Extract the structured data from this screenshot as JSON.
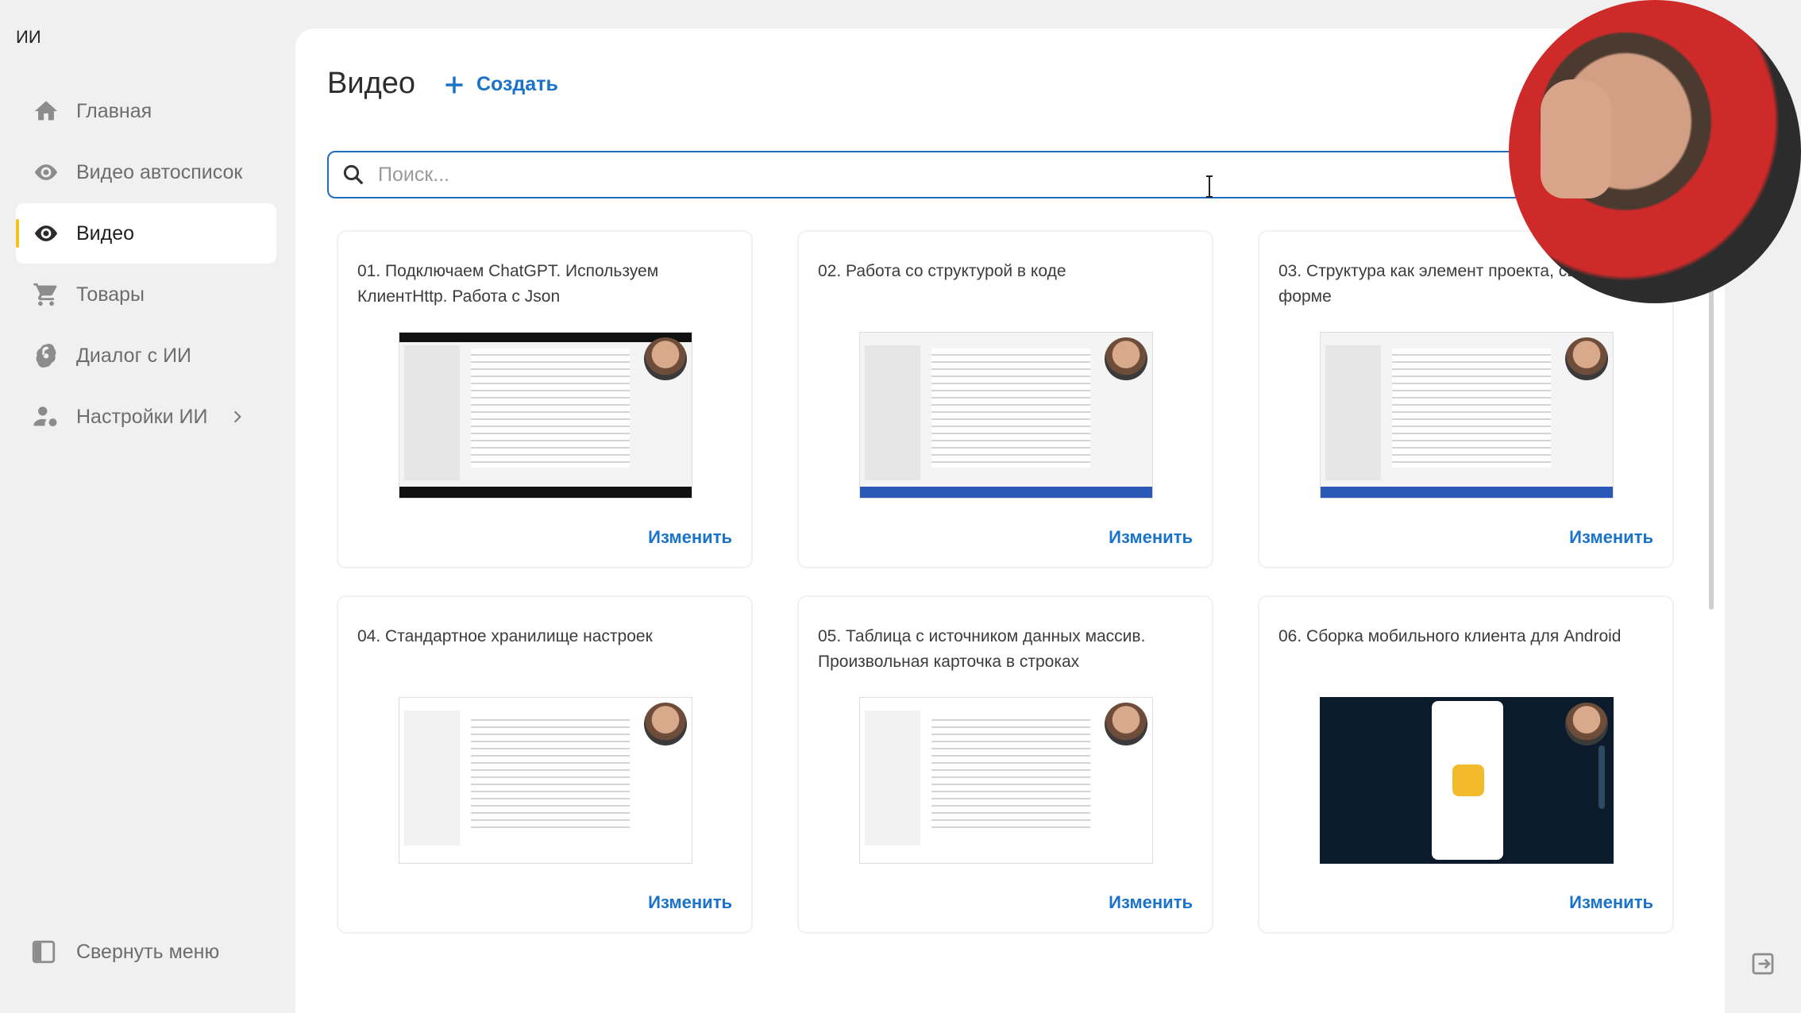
{
  "app": {
    "title": "ИИ"
  },
  "sidebar": {
    "items": [
      {
        "label": "Главная",
        "icon": "home-icon",
        "active": false
      },
      {
        "label": "Видео автосписок",
        "icon": "eye-icon",
        "active": false
      },
      {
        "label": "Видео",
        "icon": "eye-icon",
        "active": true
      },
      {
        "label": "Товары",
        "icon": "cart-icon",
        "active": false
      },
      {
        "label": "Диалог с ИИ",
        "icon": "openai-icon",
        "active": false
      },
      {
        "label": "Настройки ИИ",
        "icon": "user-settings-icon",
        "active": false,
        "has_submenu": true
      }
    ],
    "collapse_label": "Свернуть меню"
  },
  "main": {
    "title": "Видео",
    "create_label": "Создать",
    "search": {
      "placeholder": "Поиск...",
      "value": ""
    },
    "cards": [
      {
        "title": "01. Подключаем ChatGPT. Используем КлиентHttp. Работа с Json",
        "edit_label": "Изменить"
      },
      {
        "title": "02. Работа со структурой в коде",
        "edit_label": "Изменить"
      },
      {
        "title": "03. Структура как элемент проекта, свойство на форме",
        "edit_label": "Изменить"
      },
      {
        "title": "04. Стандартное хранилище настроек",
        "edit_label": "Изменить"
      },
      {
        "title": "05. Таблица с источником данных массив. Произвольная карточка в строках",
        "edit_label": "Изменить"
      },
      {
        "title": "06. Сборка мобильного клиента для Android",
        "edit_label": "Изменить"
      }
    ]
  },
  "colors": {
    "accent": "#1a73c8",
    "active_marker": "#f3c21b",
    "search_border": "#1e6ec0"
  }
}
